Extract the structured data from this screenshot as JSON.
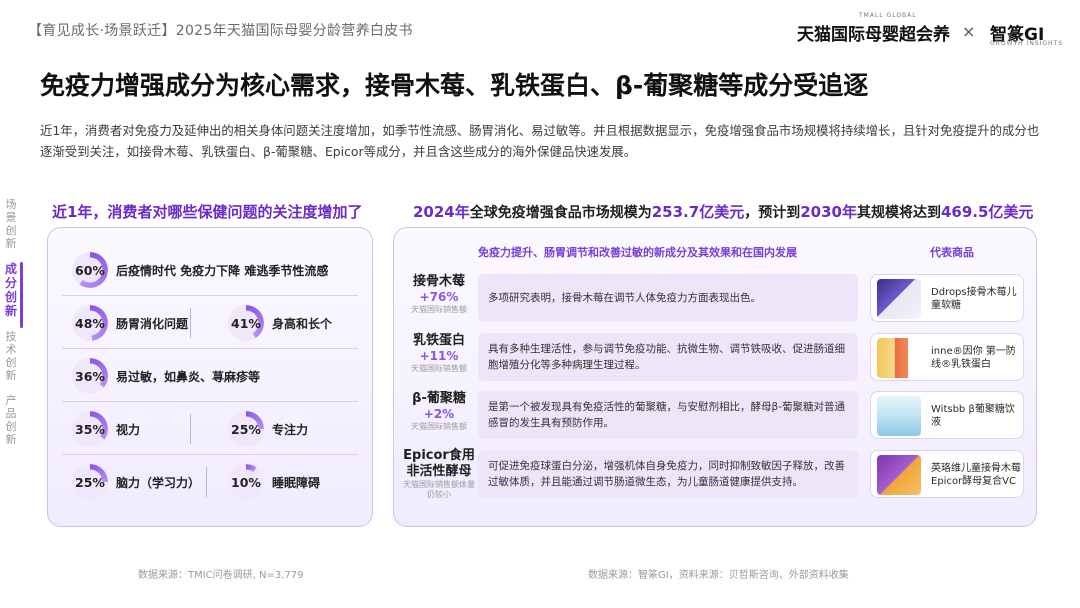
{
  "header": {
    "doc_title": "【育见成长·场景跃迁】2025年天猫国际母婴分龄营养白皮书",
    "brand_tmall": "天猫国际母婴超会养",
    "brand_tmall_small": "TMALL GLOBAL",
    "separator": "×",
    "brand_gi": "智篆GI",
    "brand_gi_small": "GROWTH INSIGHTS"
  },
  "page_title": "免疫力增强成分为核心需求，接骨木莓、乳铁蛋白、β-葡聚糖等成分受追逐",
  "intro": "近1年，消费者对免疫力及延伸出的相关身体问题关注度增加，如季节性流感、肠胃消化、易过敏等。并且根据数据显示，免疫增强食品市场规模将持续增长，且针对免疫提升的成分也逐渐受到关注，如接骨木莓、乳铁蛋白、β-葡聚糖、Epicor等成分，并且含这些成分的海外保健品快速发展。",
  "side_nav": [
    "场景创新",
    "成分创新",
    "技术创新",
    "产品创新"
  ],
  "left": {
    "heading": "近1年，消费者对哪些保健问题的关注度增加了",
    "stats": [
      {
        "pct": "60%",
        "value": 60,
        "label": "后疫情时代 免疫力下降 难逃季节性流感"
      },
      {
        "pct": "48%",
        "value": 48,
        "label": "肠胃消化问题"
      },
      {
        "pct": "41%",
        "value": 41,
        "label": "身高和长个"
      },
      {
        "pct": "36%",
        "value": 36,
        "label": "易过敏，如鼻炎、荨麻疹等"
      },
      {
        "pct": "35%",
        "value": 35,
        "label": "视力"
      },
      {
        "pct": "25%",
        "value": 25,
        "label": "专注力"
      },
      {
        "pct": "25%",
        "value": 25,
        "label": "脑力（学习力）"
      },
      {
        "pct": "10%",
        "value": 10,
        "label": "睡眠障碍"
      }
    ],
    "source": "数据来源：TMIC问卷调研, N=3,779"
  },
  "right": {
    "heading_parts": [
      "2024年",
      "全球免疫增强食品市场规模为",
      "253.7亿美元",
      "，预计到",
      "2030年",
      "其规模将达到",
      "469.5亿美元"
    ],
    "table_head": "免疫力提升、肠胃调节和改善过敏的新成分及其效果和在国内发展",
    "product_head": "代表商品",
    "rows": [
      {
        "name": "接骨木莓",
        "pct": "+76%",
        "note": "天猫国际销售额",
        "desc": "多项研究表明，接骨木莓在调节人体免疫力方面表现出色。",
        "product": "Ddrops接骨木莓儿童软糖"
      },
      {
        "name": "乳铁蛋白",
        "pct": "+11%",
        "note": "天猫国际销售额",
        "desc": "具有多种生理活性，参与调节免疫功能、抗微生物、调节铁吸收、促进肠道细胞增殖分化等多种病理生理过程。",
        "product": "inne®因你 第一防线®乳铁蛋白"
      },
      {
        "name": "β-葡聚糖",
        "pct": "+2%",
        "note": "天猫国际销售额",
        "desc": "是第一个被发现具有免疫活性的葡聚糖，与安慰剂相比，酵母β-葡聚糖对普通感冒的发生具有预防作用。",
        "product": "Witsbb β葡聚糖饮液"
      },
      {
        "name": "Epicor食用非活性酵母",
        "pct": "",
        "note": "天猫国际销售额体量仍较小",
        "desc": "可促进免疫球蛋白分泌，增强机体自身免疫力，同时抑制致敏因子释放，改善过敏体质，并且能通过调节肠道微生态，为儿童肠道健康提供支持。",
        "product": "英珞维儿童接骨木莓Epicor酵母复合VC"
      }
    ],
    "source": "数据来源：智篆GI，资料来源：贝哲斯咨询、外部资料收集"
  },
  "colors": {
    "accent": "#7a3fd8",
    "accent_light": "#b690f0",
    "panel_border": "#cfc0ef"
  }
}
